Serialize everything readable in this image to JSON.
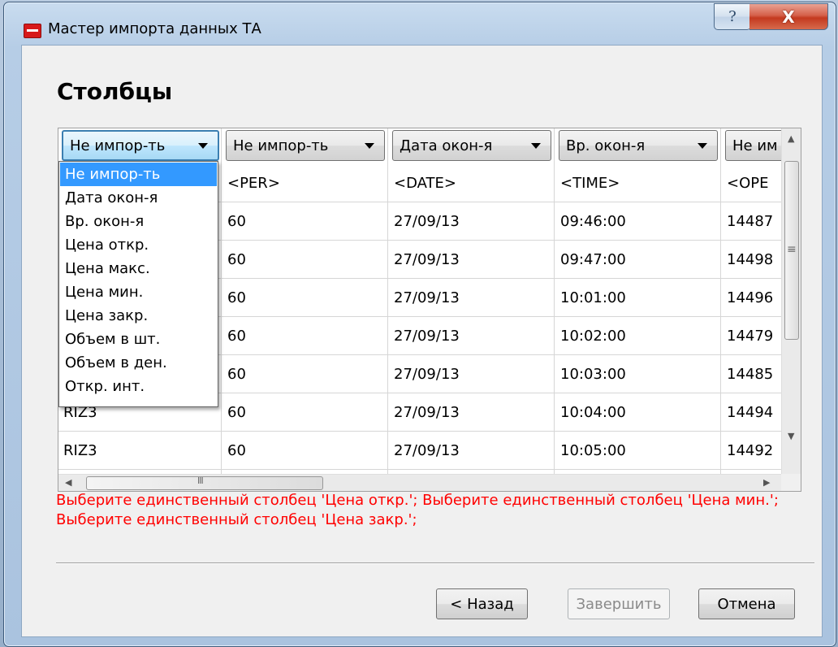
{
  "window": {
    "title": "Мастер импорта данных ТА",
    "help_glyph": "?",
    "close_glyph": "X"
  },
  "page": {
    "heading": "Столбцы"
  },
  "columns": [
    {
      "combo": "Не импор-ть",
      "header": ""
    },
    {
      "combo": "Не импор-ть",
      "header": "<PER>"
    },
    {
      "combo": "Дата окон-я",
      "header": "<DATE>"
    },
    {
      "combo": "Вр. окон-я",
      "header": "<TIME>"
    },
    {
      "combo": "Не им",
      "header": "<OPE"
    }
  ],
  "rows": [
    {
      "ticker": "",
      "per": "60",
      "date": "27/09/13",
      "time": "09:46:00",
      "open": "14487"
    },
    {
      "ticker": "",
      "per": "60",
      "date": "27/09/13",
      "time": "09:47:00",
      "open": "14498"
    },
    {
      "ticker": "",
      "per": "60",
      "date": "27/09/13",
      "time": "10:01:00",
      "open": "14496"
    },
    {
      "ticker": "",
      "per": "60",
      "date": "27/09/13",
      "time": "10:02:00",
      "open": "14479"
    },
    {
      "ticker": "",
      "per": "60",
      "date": "27/09/13",
      "time": "10:03:00",
      "open": "14485"
    },
    {
      "ticker": "RIZ3",
      "per": "60",
      "date": "27/09/13",
      "time": "10:04:00",
      "open": "14494"
    },
    {
      "ticker": "RIZ3",
      "per": "60",
      "date": "27/09/13",
      "time": "10:05:00",
      "open": "14492"
    }
  ],
  "dropdown": {
    "selected_index": 0,
    "options": [
      "Не импор-ть",
      "Дата окон-я",
      "Вр. окон-я",
      "Цена откр.",
      "Цена макс.",
      "Цена мин.",
      "Цена закр.",
      "Объем в шт.",
      "Объем в ден.",
      "Откр. инт."
    ]
  },
  "validation_error": "Выберите единственный столбец 'Цена откр.'; Выберите единственный столбец 'Цена мин.'; Выберите единственный столбец 'Цена закр.';",
  "scroll": {
    "vertical_grip": "≡",
    "horizontal_grip": "III"
  },
  "buttons": {
    "back": "< Назад",
    "finish": "Завершить",
    "cancel": "Отмена"
  },
  "colors": {
    "error": "#ff0000",
    "selection": "#3399ff",
    "close_button": "#c4391f"
  },
  "icons": [
    "app-icon",
    "help-icon",
    "close-icon",
    "dropdown-arrow-icon",
    "scroll-arrow-icon"
  ]
}
